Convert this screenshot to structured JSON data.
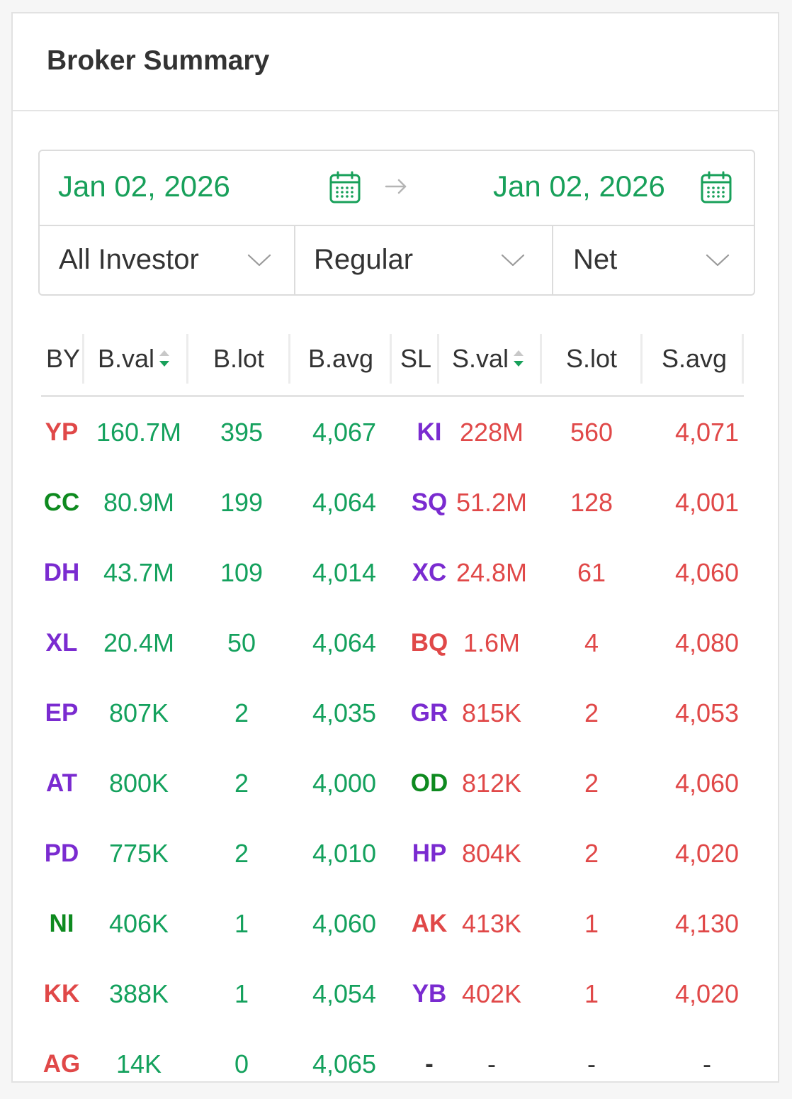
{
  "title": "Broker Summary",
  "date_range": {
    "start": "Jan 02, 2026",
    "end": "Jan 02, 2026"
  },
  "filters": {
    "investor": "All Investor",
    "market": "Regular",
    "type": "Net"
  },
  "table": {
    "headers": {
      "by": "BY",
      "bval": "B.val",
      "blot": "B.lot",
      "bavg": "B.avg",
      "sl": "SL",
      "sval": "S.val",
      "slot": "S.lot",
      "savg": "S.avg"
    },
    "rows": [
      {
        "by": "YP",
        "by_color": "#e04848",
        "bval": "160.7M",
        "blot": "395",
        "bavg": "4,067",
        "sl": "KI",
        "sl_color": "#7a2bd0",
        "sval": "228M",
        "slot": "560",
        "savg": "4,071"
      },
      {
        "by": "CC",
        "by_color": "#0e8a1f",
        "bval": "80.9M",
        "blot": "199",
        "bavg": "4,064",
        "sl": "SQ",
        "sl_color": "#7a2bd0",
        "sval": "51.2M",
        "slot": "128",
        "savg": "4,001"
      },
      {
        "by": "DH",
        "by_color": "#7a2bd0",
        "bval": "43.7M",
        "blot": "109",
        "bavg": "4,014",
        "sl": "XC",
        "sl_color": "#7a2bd0",
        "sval": "24.8M",
        "slot": "61",
        "savg": "4,060"
      },
      {
        "by": "XL",
        "by_color": "#7a2bd0",
        "bval": "20.4M",
        "blot": "50",
        "bavg": "4,064",
        "sl": "BQ",
        "sl_color": "#e04848",
        "sval": "1.6M",
        "slot": "4",
        "savg": "4,080"
      },
      {
        "by": "EP",
        "by_color": "#7a2bd0",
        "bval": "807K",
        "blot": "2",
        "bavg": "4,035",
        "sl": "GR",
        "sl_color": "#7a2bd0",
        "sval": "815K",
        "slot": "2",
        "savg": "4,053"
      },
      {
        "by": "AT",
        "by_color": "#7a2bd0",
        "bval": "800K",
        "blot": "2",
        "bavg": "4,000",
        "sl": "OD",
        "sl_color": "#0e8a1f",
        "sval": "812K",
        "slot": "2",
        "savg": "4,060"
      },
      {
        "by": "PD",
        "by_color": "#7a2bd0",
        "bval": "775K",
        "blot": "2",
        "bavg": "4,010",
        "sl": "HP",
        "sl_color": "#7a2bd0",
        "sval": "804K",
        "slot": "2",
        "savg": "4,020"
      },
      {
        "by": "NI",
        "by_color": "#0e8a1f",
        "bval": "406K",
        "blot": "1",
        "bavg": "4,060",
        "sl": "AK",
        "sl_color": "#e04848",
        "sval": "413K",
        "slot": "1",
        "savg": "4,130"
      },
      {
        "by": "KK",
        "by_color": "#e04848",
        "bval": "388K",
        "blot": "1",
        "bavg": "4,054",
        "sl": "YB",
        "sl_color": "#7a2bd0",
        "sval": "402K",
        "slot": "1",
        "savg": "4,020"
      },
      {
        "by": "AG",
        "by_color": "#e04848",
        "bval": "14K",
        "blot": "0",
        "bavg": "4,065",
        "sl": "-",
        "sl_color": "#333333",
        "sval": "-",
        "slot": "-",
        "savg": "-"
      }
    ]
  },
  "colors": {
    "buy": "#14a15d",
    "sell": "#e04848",
    "text": "#333333",
    "border": "#dcdcdc"
  },
  "icons": {
    "calendar": "calendar-icon",
    "arrow": "arrow-right-icon",
    "chevron": "chevron-down-icon",
    "sort": "sort-icon"
  }
}
